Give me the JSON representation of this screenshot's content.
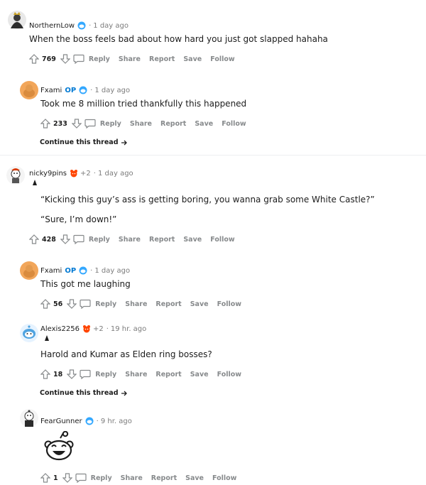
{
  "colors": {
    "op": "#0079d3",
    "meta": "#7c7c7c",
    "action": "#878a8c",
    "text": "#1c1c1c"
  },
  "icons": [
    "upvote-icon",
    "downvote-icon",
    "comment-icon",
    "arrow-right-icon",
    "award-icon",
    "snoo-icon"
  ],
  "actions": {
    "reply": "Reply",
    "share": "Share",
    "report": "Report",
    "save": "Save",
    "follow": "Follow"
  },
  "op_label": "OP",
  "separator": "·",
  "continue_label": "Continue this thread",
  "comments": [
    {
      "author": "NorthernLow",
      "time": "1 day ago",
      "text": "When the boss feels bad about how hard you just got slapped hahaha",
      "score": "769"
    },
    {
      "author": "Fxami",
      "time": "1 day ago",
      "text": "Took me 8 million tried thankfully this happened",
      "score": "233"
    },
    {
      "author": "nicky9pins",
      "awards": "+2",
      "time": "1 day ago",
      "text": "“Kicking this guy’s ass is getting boring, you wanna grab some White Castle?”",
      "text2": "“Sure, I’m down!”",
      "score": "428"
    },
    {
      "author": "Fxami",
      "time": "1 day ago",
      "text": "This got me laughing",
      "score": "56"
    },
    {
      "author": "Alexis2256",
      "awards": "+2",
      "time": "19 hr. ago",
      "text": "Harold and Kumar as Elden ring bosses?",
      "score": "18"
    },
    {
      "author": "FearGunner",
      "time": "9 hr. ago",
      "score": "1"
    }
  ]
}
